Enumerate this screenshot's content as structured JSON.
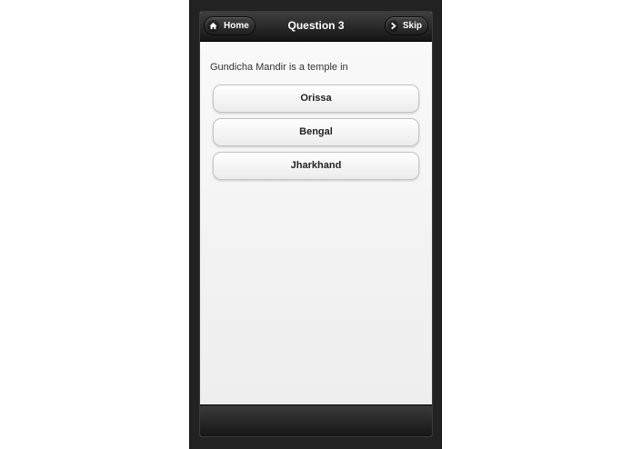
{
  "header": {
    "title": "Question 3",
    "home_label": "Home",
    "skip_label": "Skip"
  },
  "quiz": {
    "question": "Gundicha Mandir is a temple in",
    "answers": [
      {
        "label": "Orissa"
      },
      {
        "label": "Bengal"
      },
      {
        "label": "Jharkhand"
      }
    ]
  },
  "icons": {
    "home": "home-icon",
    "skip": "chevron-right-icon"
  },
  "colors": {
    "header_bg": "#1e1e1e",
    "content_bg": "#f2f2f2",
    "device_bg": "#222222"
  }
}
